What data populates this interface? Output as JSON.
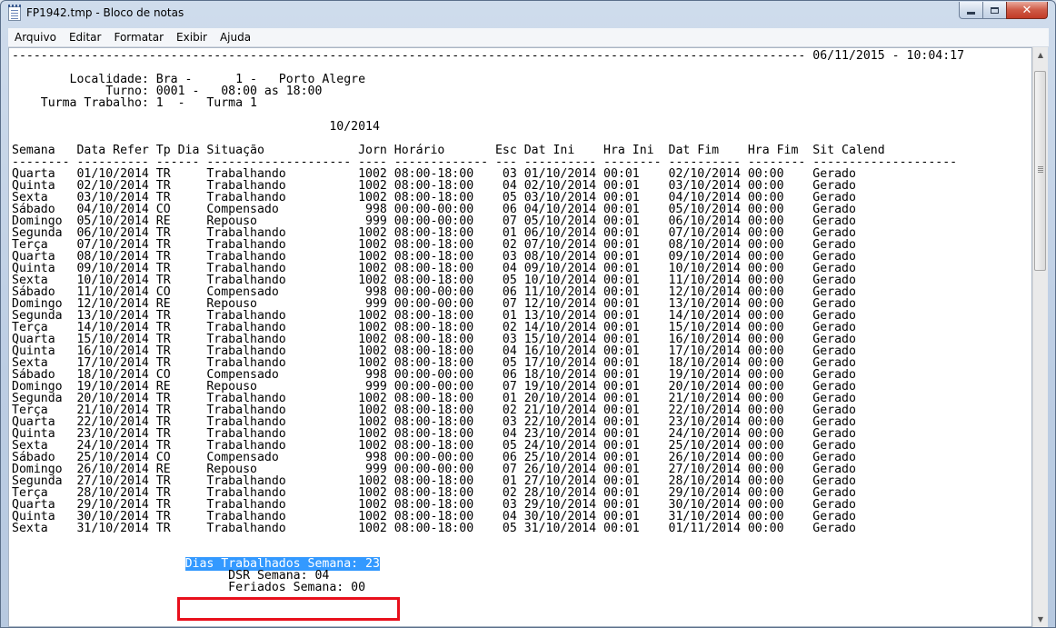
{
  "window": {
    "title": "FP1942.tmp - Bloco de notas",
    "controls": {
      "close": "✕"
    }
  },
  "menu": [
    "Arquivo",
    "Editar",
    "Formatar",
    "Exibir",
    "Ajuda"
  ],
  "document": {
    "header_rule": "-------------------------------------------------------------------------------------------------------------- 06/11/2015 - 10:04:17",
    "localidade": "        Localidade: Bra -      1 -   Porto Alegre",
    "turno": "             Turno: 0001 -   08:00 as 18:00",
    "turma": "    Turma Trabalho: 1  -   Turma 1",
    "periodo": "                                            10/2014",
    "columns": "Semana   Data Refer Tp Dia Situação             Jorn Horário       Esc Dat Ini    Hra Ini  Dat Fim    Hra Fim  Sit Calend",
    "columns_rule": "-------- ---------- ------ -------------------- ---- ------------- --- ---------- -------- ---------- -------- --------------------",
    "rows": [
      "Quarta   01/10/2014 TR     Trabalhando          1002 08:00-18:00    03 01/10/2014 00:01    02/10/2014 00:00    Gerado",
      "Quinta   02/10/2014 TR     Trabalhando          1002 08:00-18:00    04 02/10/2014 00:01    03/10/2014 00:00    Gerado",
      "Sexta    03/10/2014 TR     Trabalhando          1002 08:00-18:00    05 03/10/2014 00:01    04/10/2014 00:00    Gerado",
      "Sábado   04/10/2014 CO     Compensado            998 00:00-00:00    06 04/10/2014 00:01    05/10/2014 00:00    Gerado",
      "Domingo  05/10/2014 RE     Repouso               999 00:00-00:00    07 05/10/2014 00:01    06/10/2014 00:00    Gerado",
      "Segunda  06/10/2014 TR     Trabalhando          1002 08:00-18:00    01 06/10/2014 00:01    07/10/2014 00:00    Gerado",
      "Terça    07/10/2014 TR     Trabalhando          1002 08:00-18:00    02 07/10/2014 00:01    08/10/2014 00:00    Gerado",
      "Quarta   08/10/2014 TR     Trabalhando          1002 08:00-18:00    03 08/10/2014 00:01    09/10/2014 00:00    Gerado",
      "Quinta   09/10/2014 TR     Trabalhando          1002 08:00-18:00    04 09/10/2014 00:01    10/10/2014 00:00    Gerado",
      "Sexta    10/10/2014 TR     Trabalhando          1002 08:00-18:00    05 10/10/2014 00:01    11/10/2014 00:00    Gerado",
      "Sábado   11/10/2014 CO     Compensado            998 00:00-00:00    06 11/10/2014 00:01    12/10/2014 00:00    Gerado",
      "Domingo  12/10/2014 RE     Repouso               999 00:00-00:00    07 12/10/2014 00:01    13/10/2014 00:00    Gerado",
      "Segunda  13/10/2014 TR     Trabalhando          1002 08:00-18:00    01 13/10/2014 00:01    14/10/2014 00:00    Gerado",
      "Terça    14/10/2014 TR     Trabalhando          1002 08:00-18:00    02 14/10/2014 00:01    15/10/2014 00:00    Gerado",
      "Quarta   15/10/2014 TR     Trabalhando          1002 08:00-18:00    03 15/10/2014 00:01    16/10/2014 00:00    Gerado",
      "Quinta   16/10/2014 TR     Trabalhando          1002 08:00-18:00    04 16/10/2014 00:01    17/10/2014 00:00    Gerado",
      "Sexta    17/10/2014 TR     Trabalhando          1002 08:00-18:00    05 17/10/2014 00:01    18/10/2014 00:00    Gerado",
      "Sábado   18/10/2014 CO     Compensado            998 00:00-00:00    06 18/10/2014 00:01    19/10/2014 00:00    Gerado",
      "Domingo  19/10/2014 RE     Repouso               999 00:00-00:00    07 19/10/2014 00:01    20/10/2014 00:00    Gerado",
      "Segunda  20/10/2014 TR     Trabalhando          1002 08:00-18:00    01 20/10/2014 00:01    21/10/2014 00:00    Gerado",
      "Terça    21/10/2014 TR     Trabalhando          1002 08:00-18:00    02 21/10/2014 00:01    22/10/2014 00:00    Gerado",
      "Quarta   22/10/2014 TR     Trabalhando          1002 08:00-18:00    03 22/10/2014 00:01    23/10/2014 00:00    Gerado",
      "Quinta   23/10/2014 TR     Trabalhando          1002 08:00-18:00    04 23/10/2014 00:01    24/10/2014 00:00    Gerado",
      "Sexta    24/10/2014 TR     Trabalhando          1002 08:00-18:00    05 24/10/2014 00:01    25/10/2014 00:00    Gerado",
      "Sábado   25/10/2014 CO     Compensado            998 00:00-00:00    06 25/10/2014 00:01    26/10/2014 00:00    Gerado",
      "Domingo  26/10/2014 RE     Repouso               999 00:00-00:00    07 26/10/2014 00:01    27/10/2014 00:00    Gerado",
      "Segunda  27/10/2014 TR     Trabalhando          1002 08:00-18:00    01 27/10/2014 00:01    28/10/2014 00:00    Gerado",
      "Terça    28/10/2014 TR     Trabalhando          1002 08:00-18:00    02 28/10/2014 00:01    29/10/2014 00:00    Gerado",
      "Quarta   29/10/2014 TR     Trabalhando          1002 08:00-18:00    03 29/10/2014 00:01    30/10/2014 00:00    Gerado",
      "Quinta   30/10/2014 TR     Trabalhando          1002 08:00-18:00    04 30/10/2014 00:01    31/10/2014 00:00    Gerado",
      "Sexta    31/10/2014 TR     Trabalhando          1002 08:00-18:00    05 31/10/2014 00:01    01/11/2014 00:00    Gerado"
    ],
    "summary": {
      "dias_indent": "                        ",
      "dias_selected": "Dias Trabalhados Semana: 23",
      "dsr": "                              DSR Semana: 04",
      "feriados": "                              Feriados Semana: 00"
    }
  },
  "colors": {
    "selection": "#3399ff",
    "highlight_box": "#e8101c"
  }
}
